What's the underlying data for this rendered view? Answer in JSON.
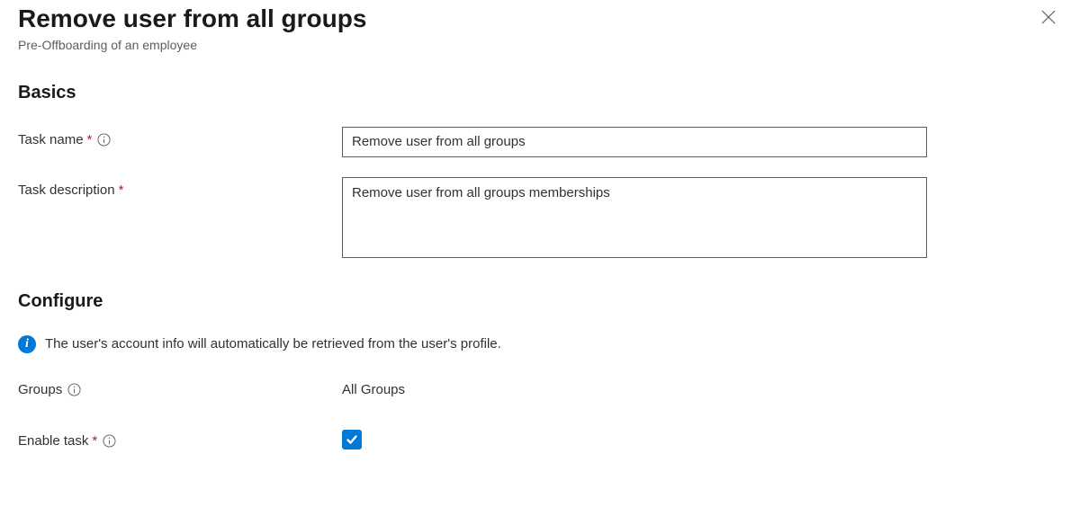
{
  "header": {
    "title": "Remove user from all groups",
    "subtitle": "Pre-Offboarding of an employee"
  },
  "sections": {
    "basics_heading": "Basics",
    "configure_heading": "Configure"
  },
  "fields": {
    "task_name": {
      "label": "Task name",
      "value": "Remove user from all groups"
    },
    "task_description": {
      "label": "Task description",
      "value": "Remove user from all groups memberships"
    },
    "groups": {
      "label": "Groups",
      "value": "All Groups"
    },
    "enable_task": {
      "label": "Enable task",
      "checked": true
    }
  },
  "info_banner": "The user's account info will automatically be retrieved from the user's profile."
}
